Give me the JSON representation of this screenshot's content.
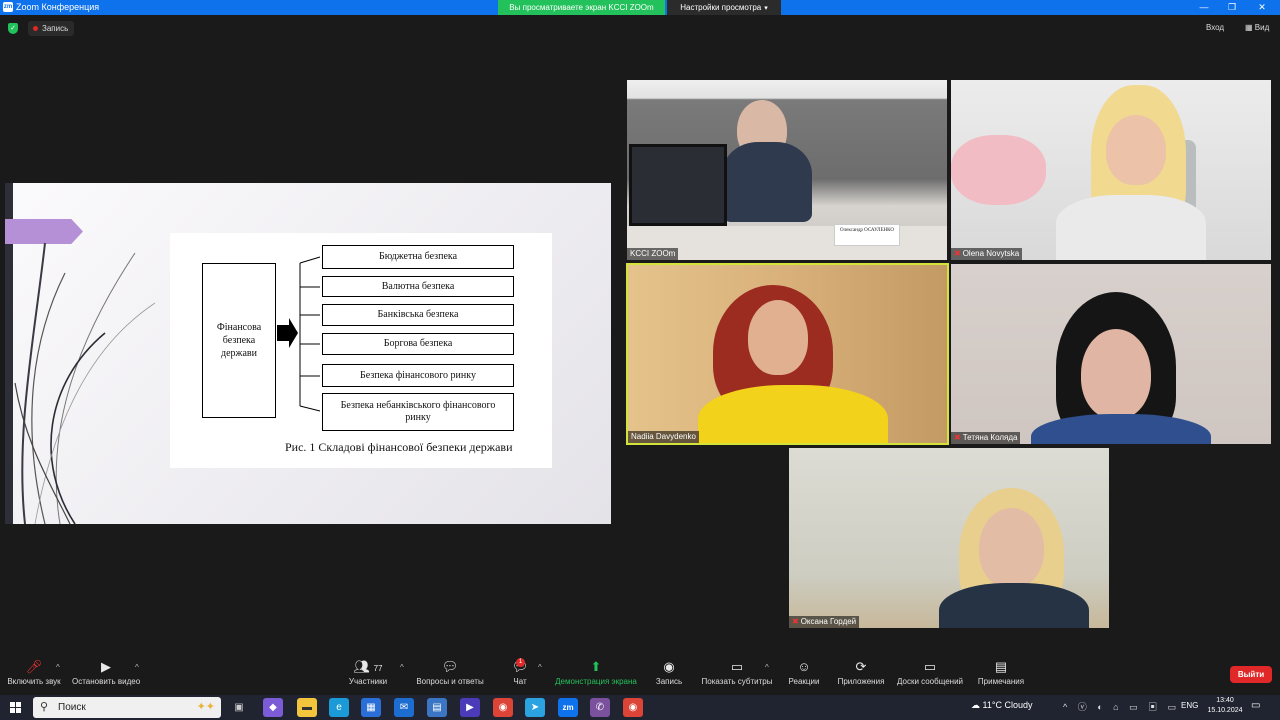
{
  "window": {
    "title": "Zoom Конференция",
    "share_banner": "Вы просматриваете экран KCCI ZOOm",
    "view_settings": "Настройки просмотра"
  },
  "top": {
    "record": "Запись",
    "exit_fullscreen": "Вход",
    "view": "Вид"
  },
  "slide": {
    "main_box": "Фінансова безпека держави",
    "components": [
      "Бюджетна безпека",
      "Валютна безпека",
      "Банківська  безпека",
      "Боргова безпека",
      "Безпека фінансового ринку",
      "Безпека небанківського фінансового ринку"
    ],
    "caption": "Рис. 1 Складові фінансової безпеки держави"
  },
  "participants": [
    {
      "name": "KCCI ZOOm",
      "muted": false
    },
    {
      "name": "Olena Novytska",
      "muted": true
    },
    {
      "name": "Nadiia Davydenko",
      "muted": false,
      "speaking": true
    },
    {
      "name": "Тетяна Коляда",
      "muted": true
    },
    {
      "name": "Оксана Гордей",
      "muted": true
    }
  ],
  "t1_nameplate": "Олександр ОСАУЛЕНКО",
  "toolbar": {
    "unmute": "Включить звук",
    "stop_video": "Остановить видео",
    "participants_count": "77",
    "participants": "Участники",
    "qa": "Вопросы и ответы",
    "chat": "Чат",
    "chat_badge": "1",
    "share": "Демонстрация экрана",
    "record": "Запись",
    "captions": "Показать субтитры",
    "reactions": "Реакции",
    "apps": "Приложения",
    "whiteboards": "Доски сообщений",
    "notes": "Примечания",
    "leave": "Выйти"
  },
  "taskbar": {
    "search": "Поиск",
    "weather": "11°C  Cloudy",
    "lang": "ENG",
    "time": "13:40",
    "date": "15.10.2024"
  },
  "colors": {
    "zoom_blue": "#0e72ed",
    "share_green": "#23c15b",
    "leave_red": "#e02828",
    "speaker_highlight": "#d4e23c"
  }
}
